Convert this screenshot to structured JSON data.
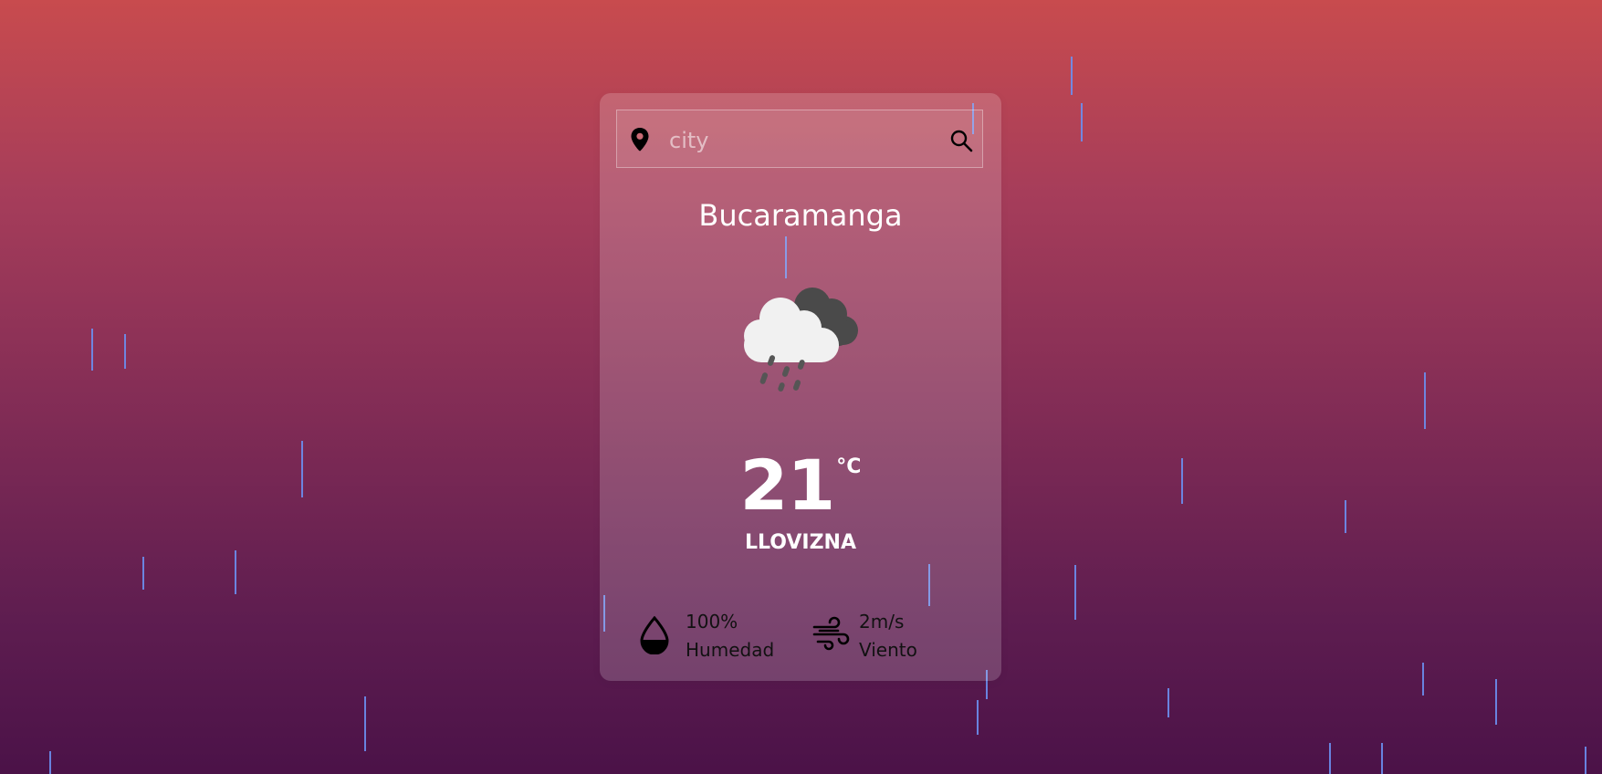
{
  "search": {
    "placeholder": "city",
    "value": ""
  },
  "weather": {
    "city": "Bucaramanga",
    "temperature": "21",
    "unit": "°C",
    "description": "LLOVIZNA",
    "icon": "cloud-drizzle-icon"
  },
  "details": {
    "humidity": {
      "value": "100%",
      "label": "Humedad",
      "icon": "water-drop-icon"
    },
    "wind": {
      "value": "2m/s",
      "label": "Viento",
      "icon": "wind-icon"
    }
  },
  "colors": {
    "rain": "#6b8ff0",
    "gradient_top": "#c84b4e",
    "gradient_bottom": "#4b1248"
  }
}
